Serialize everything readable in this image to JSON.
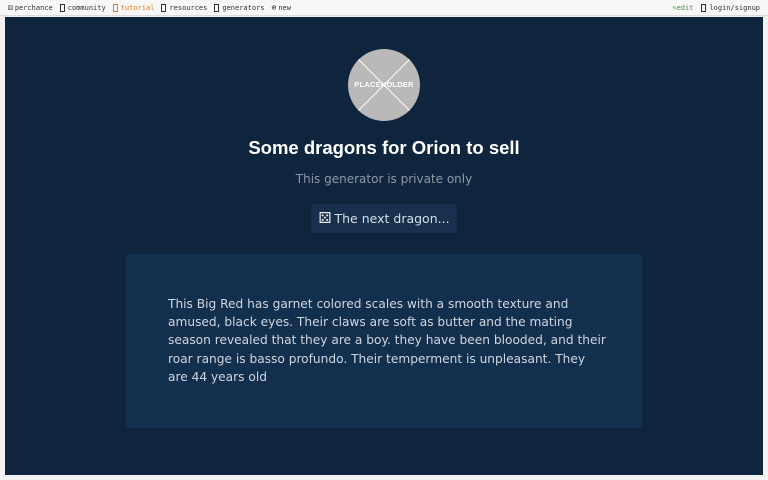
{
  "nav": {
    "left": [
      {
        "name": "nav-perchance",
        "icon": "die-icon",
        "label": "perchance"
      },
      {
        "name": "nav-community",
        "icon": "doc-icon",
        "label": "community"
      },
      {
        "name": "nav-tutorial",
        "icon": "doc-icon",
        "label": "tutorial"
      },
      {
        "name": "nav-resources",
        "icon": "doc-icon",
        "label": "resources"
      },
      {
        "name": "nav-generators",
        "icon": "doc-icon",
        "label": "generators"
      },
      {
        "name": "nav-new",
        "icon": "plus-icon",
        "label": "new"
      }
    ],
    "edit_label": "edit",
    "login_label": "login/signup"
  },
  "avatar": {
    "text": "PLACEHOLDER"
  },
  "page": {
    "title": "Some dragons for Orion to sell",
    "subtitle": "This generator is private only",
    "button_label": "The next dragon...",
    "output": "This Big Red has garnet colored scales with a smooth texture and amused, black eyes. Their claws are soft as butter and the mating season revealed that they are a boy. they have been blooded, and their roar range is basso profundo. Their temperment is unpleasant. They are 44 years old"
  },
  "colors": {
    "background": "#0f243d",
    "panel": "#132f4e",
    "button": "#17304d",
    "tutorial_accent": "#e07a1f",
    "edit_accent": "#3a9a3a"
  }
}
